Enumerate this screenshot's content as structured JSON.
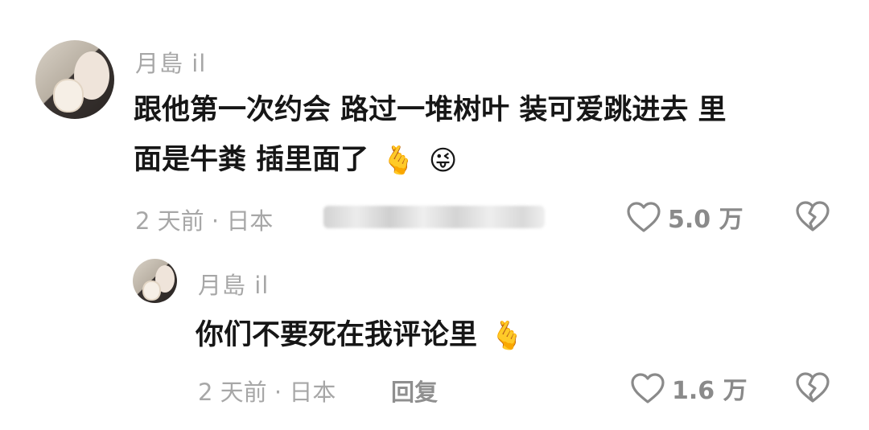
{
  "comment": {
    "username": "月島 il",
    "text_line1": "跟他第一次约会 路过一堆树叶 装可爱跳进去 里",
    "text_line2": "面是牛粪 插里面了",
    "emoji1": "🫰",
    "emoji2": "😜",
    "time": "2 天前 · 日本",
    "like_count": "5.0 万",
    "icons": {
      "like": "heart-outline-icon",
      "dislike": "broken-heart-icon"
    }
  },
  "reply": {
    "username": "月島 il",
    "text": "你们不要死在我评论里",
    "emoji": "🫰",
    "time": "2 天前 · 日本",
    "reply_label": "回复",
    "like_count": "1.6 万",
    "icons": {
      "like": "heart-outline-icon",
      "dislike": "broken-heart-icon"
    }
  }
}
